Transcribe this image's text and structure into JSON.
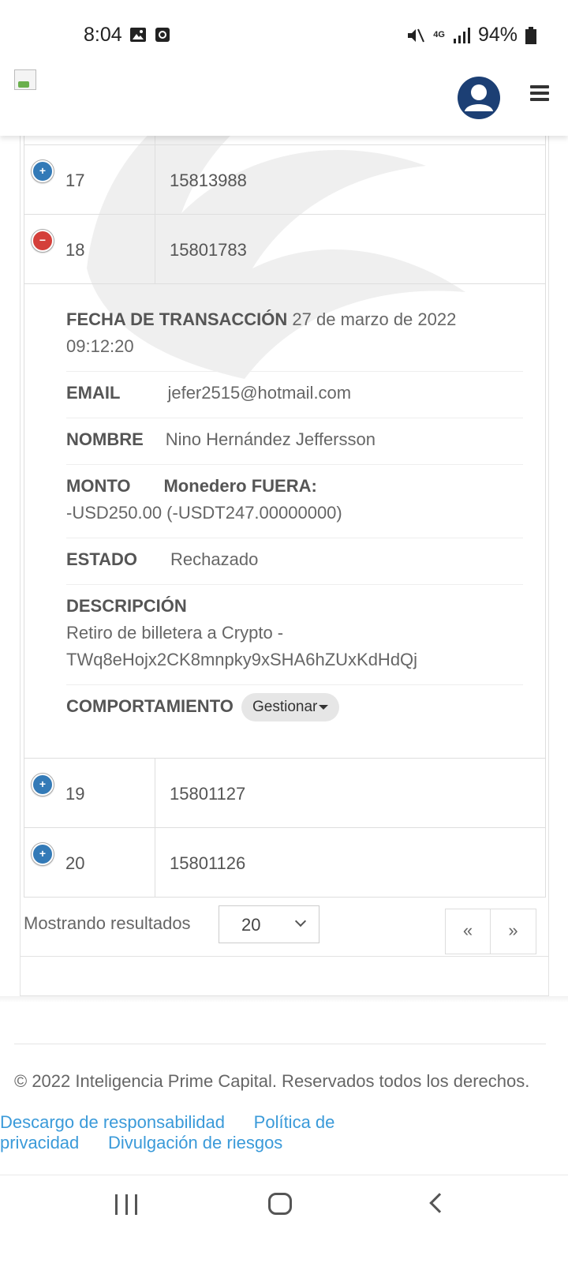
{
  "status_bar": {
    "time": "8:04",
    "network": "4G",
    "battery": "94%"
  },
  "header": {
    "logo_icon": "broken-image-icon",
    "avatar_icon": "user-icon",
    "menu_icon": "hamburger-icon"
  },
  "table": {
    "rows_before": [
      {
        "num": "17",
        "id": "15813988",
        "toggle": "+"
      },
      {
        "num": "18",
        "id": "15801783",
        "toggle": "−"
      }
    ],
    "detail": {
      "fecha_label": "FECHA DE TRANSACCIÓN",
      "fecha_value": "27 de marzo de 2022 09:12:20",
      "email_label": "EMAIL",
      "email_value": "jefer2515@hotmail.com",
      "nombre_label": "NOMBRE",
      "nombre_value": "Nino Hernández Jeffersson",
      "monto_label": "MONTO",
      "monto_sub_label": "Monedero FUERA:",
      "monto_value": "-USD250.00 (-USDT247.00000000)",
      "estado_label": "ESTADO",
      "estado_value": "Rechazado",
      "descripcion_label": "DESCRIPCIÓN",
      "descripcion_value": "Retiro de billetera a Crypto - TWq8eHojx2CK8mnpky9xSHA6hZUxKdHdQj",
      "comportamiento_label": "COMPORTAMIENTO",
      "gestionar_label": "Gestionar"
    },
    "rows_after": [
      {
        "num": "19",
        "id": "15801127",
        "toggle": "+"
      },
      {
        "num": "20",
        "id": "15801126",
        "toggle": "+"
      }
    ]
  },
  "pagination": {
    "showing_label": "Mostrando resultados",
    "page_size": "20",
    "prev_label": "«",
    "next_label": "»"
  },
  "footer": {
    "copyright": "© 2022 Inteligencia Prime Capital. Reservados todos los derechos.",
    "links": [
      "Descargo de responsabilidad",
      "Política de privacidad",
      "Divulgación de riesgos"
    ]
  }
}
